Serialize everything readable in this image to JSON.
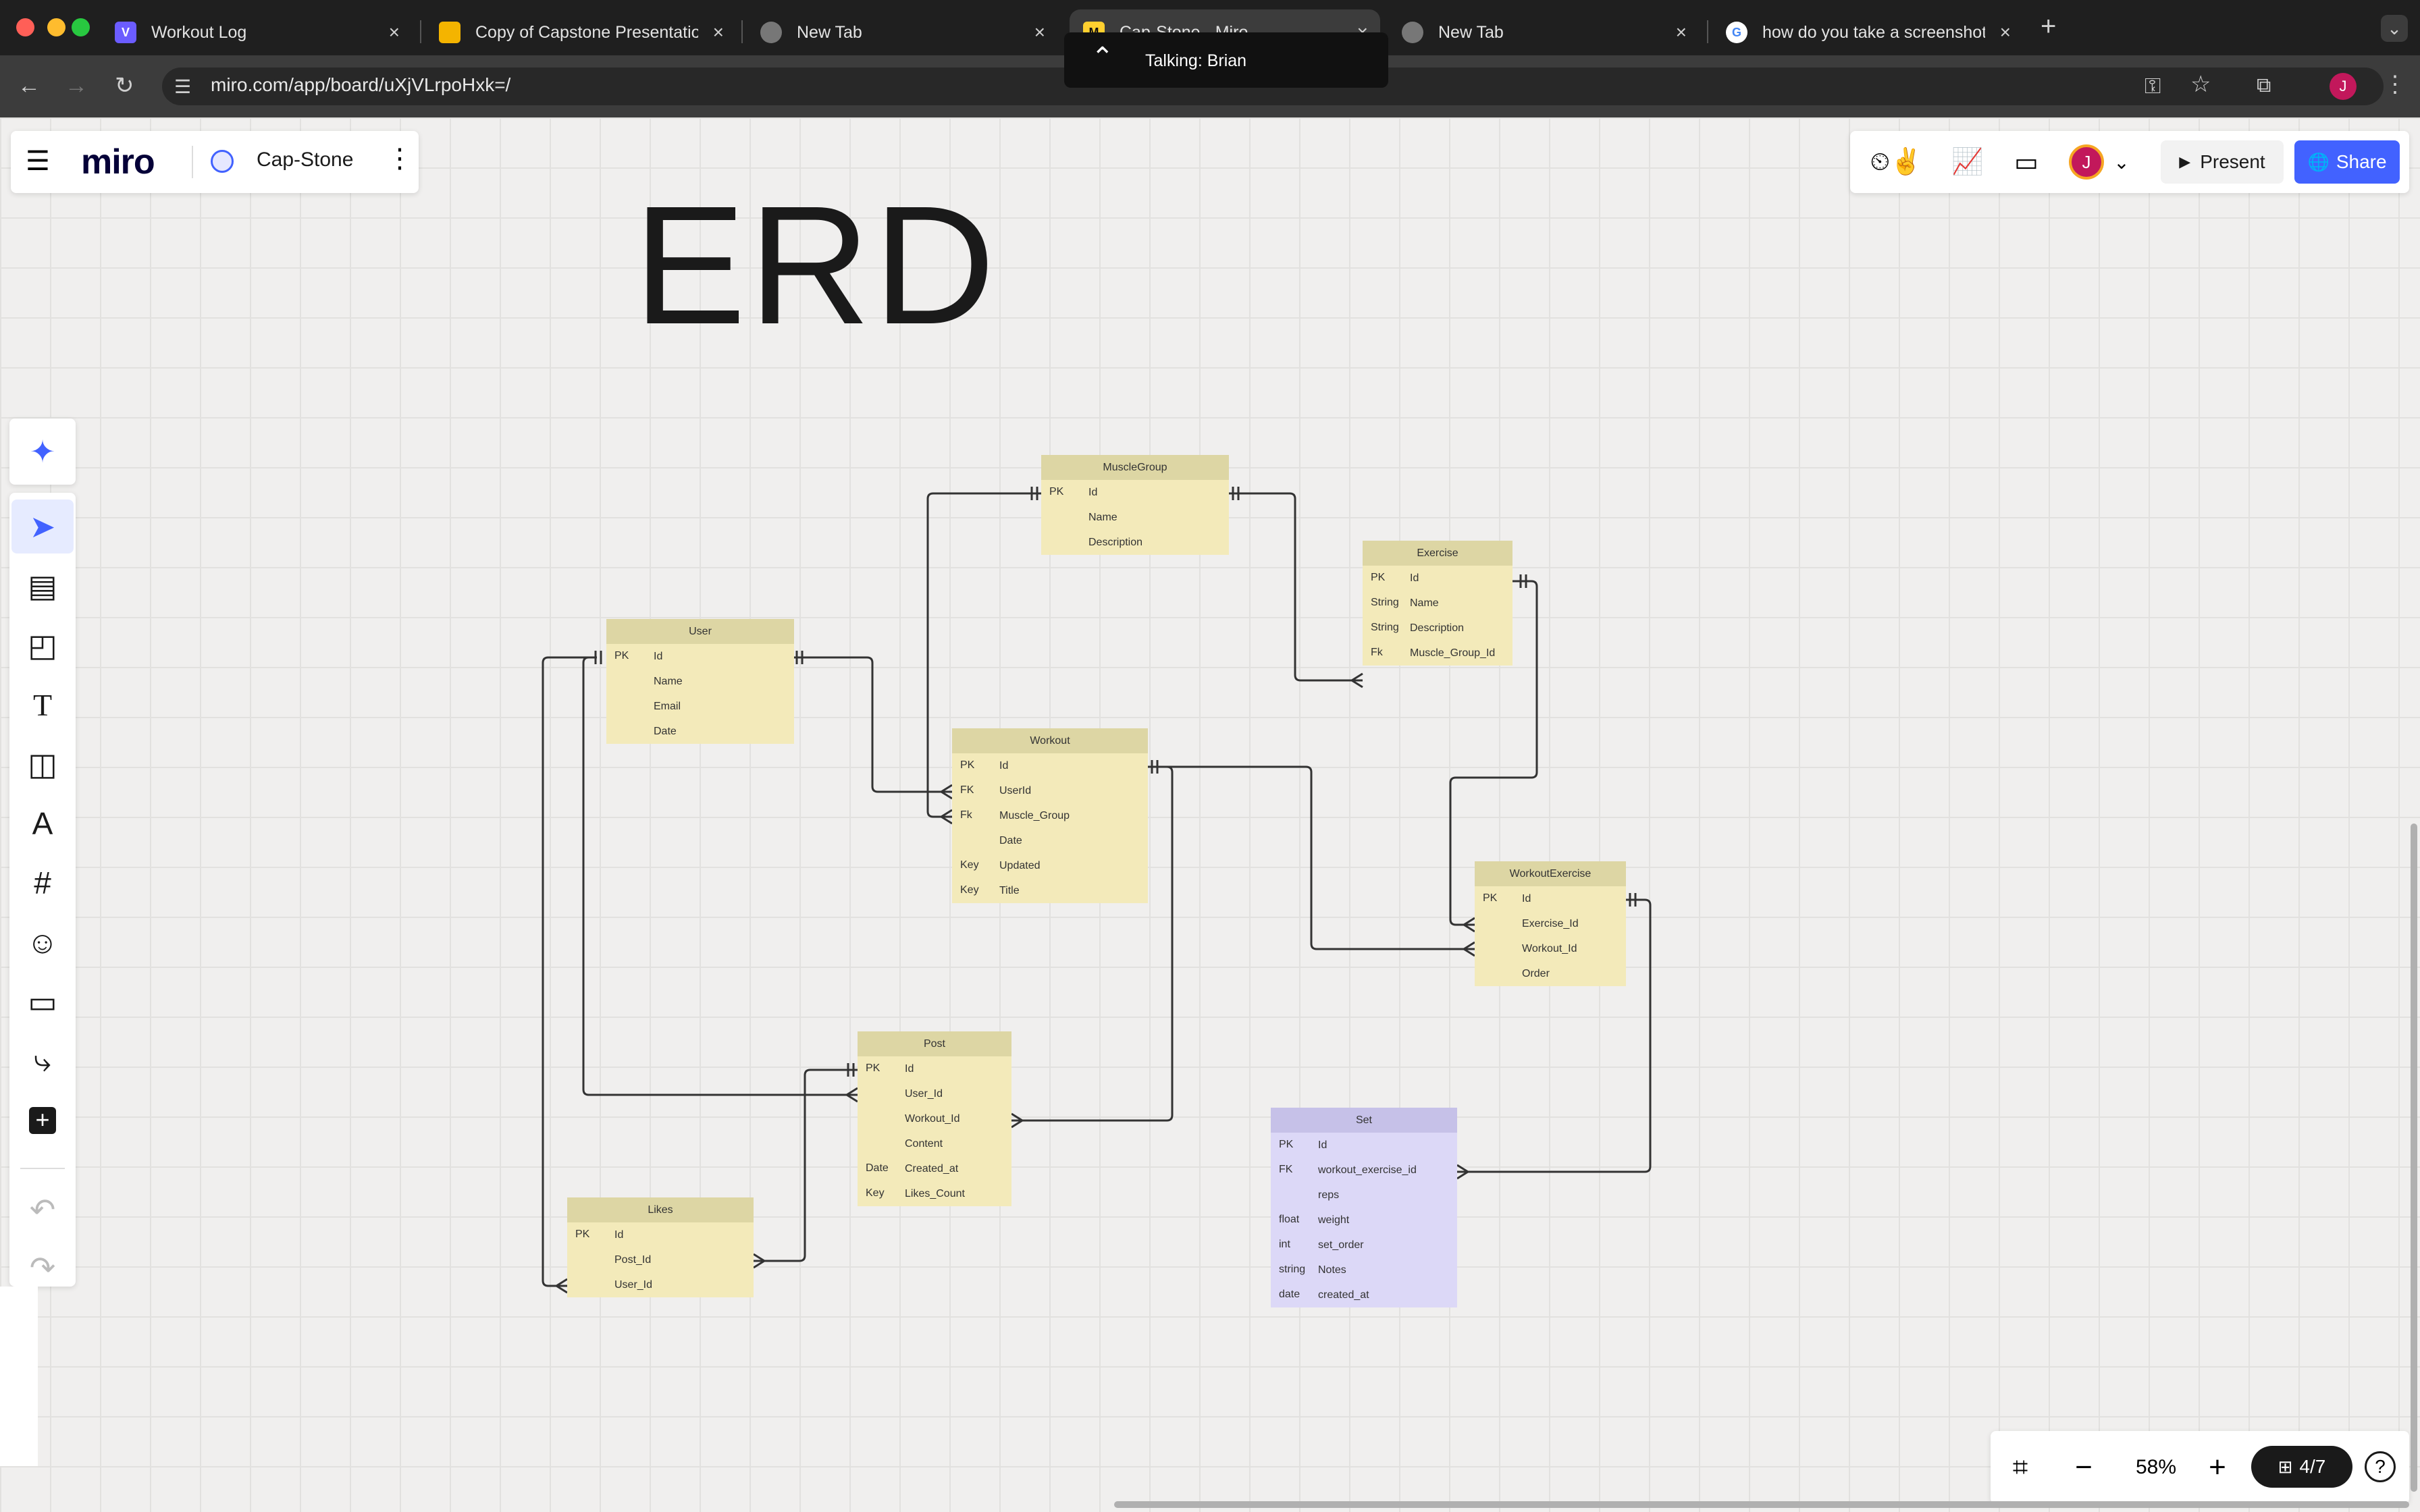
{
  "browser": {
    "tabs": [
      {
        "title": "Workout Log",
        "favicon": "V",
        "favicon_color": "#6b5cff"
      },
      {
        "title": "Copy of Capstone Presentation",
        "favicon": "",
        "favicon_color": "#f4b400"
      },
      {
        "title": "New Tab",
        "favicon": "",
        "favicon_color": "#888888"
      },
      {
        "title": "Cap-Stone - Miro",
        "favicon": "M",
        "favicon_color": "#ffd02f"
      },
      {
        "title": "New Tab",
        "favicon": "",
        "favicon_color": "#888888"
      },
      {
        "title": "how do you take a screenshot",
        "favicon": "G",
        "favicon_color": "#ffffff"
      }
    ],
    "url": "miro.com/app/board/uXjVLrpoHxk=/",
    "talking": "Talking: Brian"
  },
  "board": {
    "logo": "miro",
    "name": "Cap-Stone",
    "avatar": "J",
    "present_label": "Present",
    "share_label": "Share",
    "zoom": "58%",
    "frames": "4/7",
    "help": "?"
  },
  "erd_title": "ERD",
  "tables": [
    {
      "id": "musclegroup",
      "name": "MuscleGroup",
      "color": "yellow",
      "rows": [
        [
          "PK",
          "Id"
        ],
        [
          "",
          "Name"
        ],
        [
          "",
          "Description"
        ]
      ]
    },
    {
      "id": "exercise",
      "name": "Exercise",
      "color": "yellow",
      "rows": [
        [
          "PK",
          "Id"
        ],
        [
          "String",
          "Name"
        ],
        [
          "String",
          "Description"
        ],
        [
          "Fk",
          "Muscle_Group_Id"
        ]
      ]
    },
    {
      "id": "user",
      "name": "User",
      "color": "yellow",
      "rows": [
        [
          "PK",
          "Id"
        ],
        [
          "",
          "Name"
        ],
        [
          "",
          "Email"
        ],
        [
          "",
          "Date"
        ]
      ]
    },
    {
      "id": "workout",
      "name": "Workout",
      "color": "yellow",
      "rows": [
        [
          "PK",
          "Id"
        ],
        [
          "FK",
          "UserId"
        ],
        [
          "Fk",
          "Muscle_Group"
        ],
        [
          "",
          "Date"
        ],
        [
          "Key",
          "Updated"
        ],
        [
          "Key",
          "Title"
        ]
      ]
    },
    {
      "id": "workoutexercise",
      "name": "WorkoutExercise",
      "color": "yellow",
      "rows": [
        [
          "PK",
          "Id"
        ],
        [
          "",
          "Exercise_Id"
        ],
        [
          "",
          "Workout_Id"
        ],
        [
          "",
          "Order"
        ]
      ]
    },
    {
      "id": "post",
      "name": "Post",
      "color": "yellow",
      "rows": [
        [
          "PK",
          "Id"
        ],
        [
          "",
          "User_Id"
        ],
        [
          "",
          "Workout_Id"
        ],
        [
          "",
          "Content"
        ],
        [
          "Date",
          "Created_at"
        ],
        [
          "Key",
          "Likes_Count"
        ]
      ]
    },
    {
      "id": "likes",
      "name": "Likes",
      "color": "yellow",
      "rows": [
        [
          "PK",
          "Id"
        ],
        [
          "",
          "Post_Id"
        ],
        [
          "",
          "User_Id"
        ]
      ]
    },
    {
      "id": "set",
      "name": "Set",
      "color": "purple",
      "rows": [
        [
          "PK",
          "Id"
        ],
        [
          "FK",
          "workout_exercise_id"
        ],
        [
          "",
          "reps"
        ],
        [
          "float",
          "weight"
        ],
        [
          "int",
          "set_order"
        ],
        [
          "string",
          "Notes"
        ],
        [
          "date",
          "created_at"
        ]
      ]
    }
  ]
}
